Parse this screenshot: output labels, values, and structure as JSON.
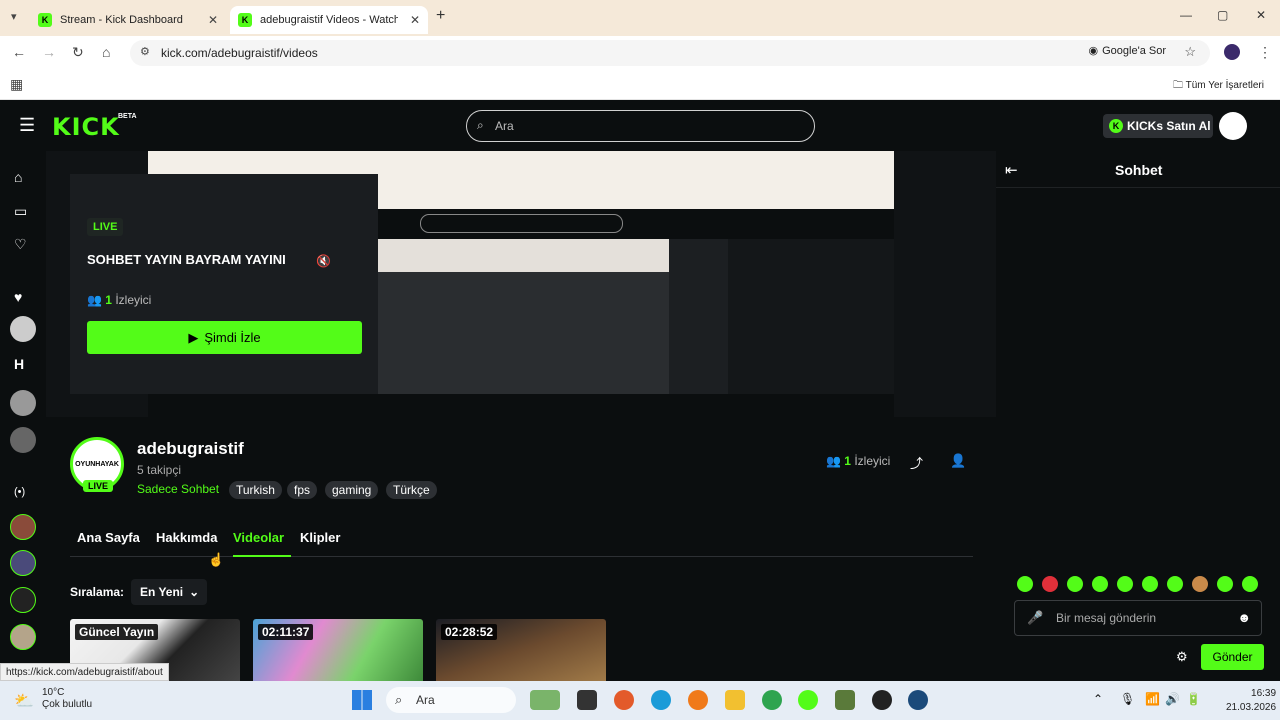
{
  "browser": {
    "tabs": [
      {
        "title": "Stream - Kick Dashboard"
      },
      {
        "title": "adebugraistif Videos - Watch Clips"
      }
    ],
    "new_tab": "+",
    "url": "kick.com/adebugraistif/videos",
    "google_sor": "Google'a Sor",
    "bookmarks_all": "Tüm Yer İşaretleri",
    "status_url": "https://kick.com/adebugraistif/about"
  },
  "header": {
    "logo": "KICK",
    "beta": "BETA",
    "search_placeholder": "Ara",
    "kicks_button": "KICKs Satın Al"
  },
  "player": {
    "live_badge": "LIVE",
    "title": "SOHBET YAYIN BAYRAM YAYINI",
    "viewer_count": "1",
    "viewer_label": "İzleyici",
    "watch_button": "Şimdi İzle"
  },
  "channel": {
    "name": "adebugraistif",
    "followers": "5 takipçi",
    "category": "Sadece Sohbet",
    "tags": [
      "Turkish",
      "fps",
      "gaming",
      "Türkçe"
    ],
    "live_badge": "LIVE",
    "avatar_text": "OYUNHAYAK",
    "viewer_count": "1",
    "viewer_label": "İzleyici"
  },
  "channel_tabs": [
    "Ana Sayfa",
    "Hakkımda",
    "Videolar",
    "Klipler"
  ],
  "sort": {
    "label": "Sıralama:",
    "value": "En Yeni"
  },
  "videos": [
    {
      "label": "Güncel Yayın"
    },
    {
      "label": "02:11:37"
    },
    {
      "label": "02:28:52"
    }
  ],
  "chat": {
    "title": "Sohbet",
    "placeholder": "Bir mesaj gönderin",
    "send_button": "Gönder"
  },
  "taskbar": {
    "temperature": "10°C",
    "weather": "Çok bulutlu",
    "search": "Ara",
    "time": "16:39",
    "date": "21.03.2026"
  },
  "colors": {
    "kick_green": "#53fc18",
    "background": "#0b0e0f"
  }
}
